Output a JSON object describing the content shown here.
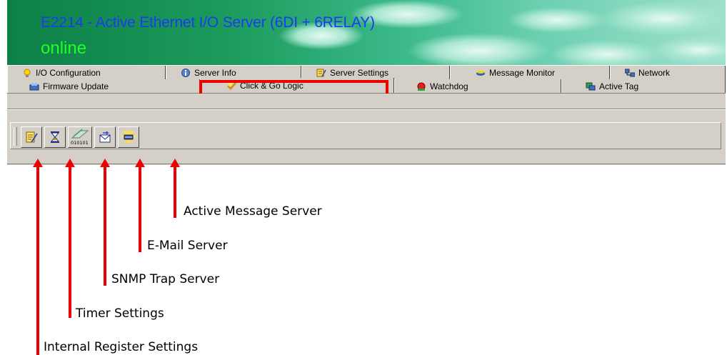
{
  "window": {
    "title": "E2214 - Active Ethernet I/O Server (6DI + 6RELAY)",
    "status": "online"
  },
  "tabs_row1": [
    {
      "label": "I/O Configuration",
      "icon": "lightbulb-icon"
    },
    {
      "label": "Server Info",
      "icon": "info-icon"
    },
    {
      "label": "Server Settings",
      "icon": "server-settings-icon"
    },
    {
      "label": "Message Monitor",
      "icon": "message-monitor-icon"
    },
    {
      "label": "Network",
      "icon": "network-icon"
    }
  ],
  "tabs_row2": [
    {
      "label": "Firmware Update",
      "icon": "firmware-icon"
    },
    {
      "label": "Click & Go Logic",
      "icon": "logic-icon",
      "active": true
    },
    {
      "label": "Watchdog",
      "icon": "watchdog-icon"
    },
    {
      "label": "Active Tag",
      "icon": "active-tag-icon"
    }
  ],
  "toolbar": [
    {
      "icon": "internal-register-icon"
    },
    {
      "icon": "timer-icon"
    },
    {
      "icon": "snmp-trap-icon",
      "text": "010101"
    },
    {
      "icon": "email-icon"
    },
    {
      "icon": "active-message-icon"
    }
  ],
  "callouts": {
    "active_message": "Active Message Server",
    "email": "E-Mail Server",
    "snmp": "SNMP Trap Server",
    "timer": "Timer Settings",
    "internal_register": "Internal Register Settings"
  },
  "colors": {
    "title": "#1a3df0",
    "status": "#22ff22",
    "highlight": "#ee0000",
    "panel": "#d4d0c8"
  }
}
